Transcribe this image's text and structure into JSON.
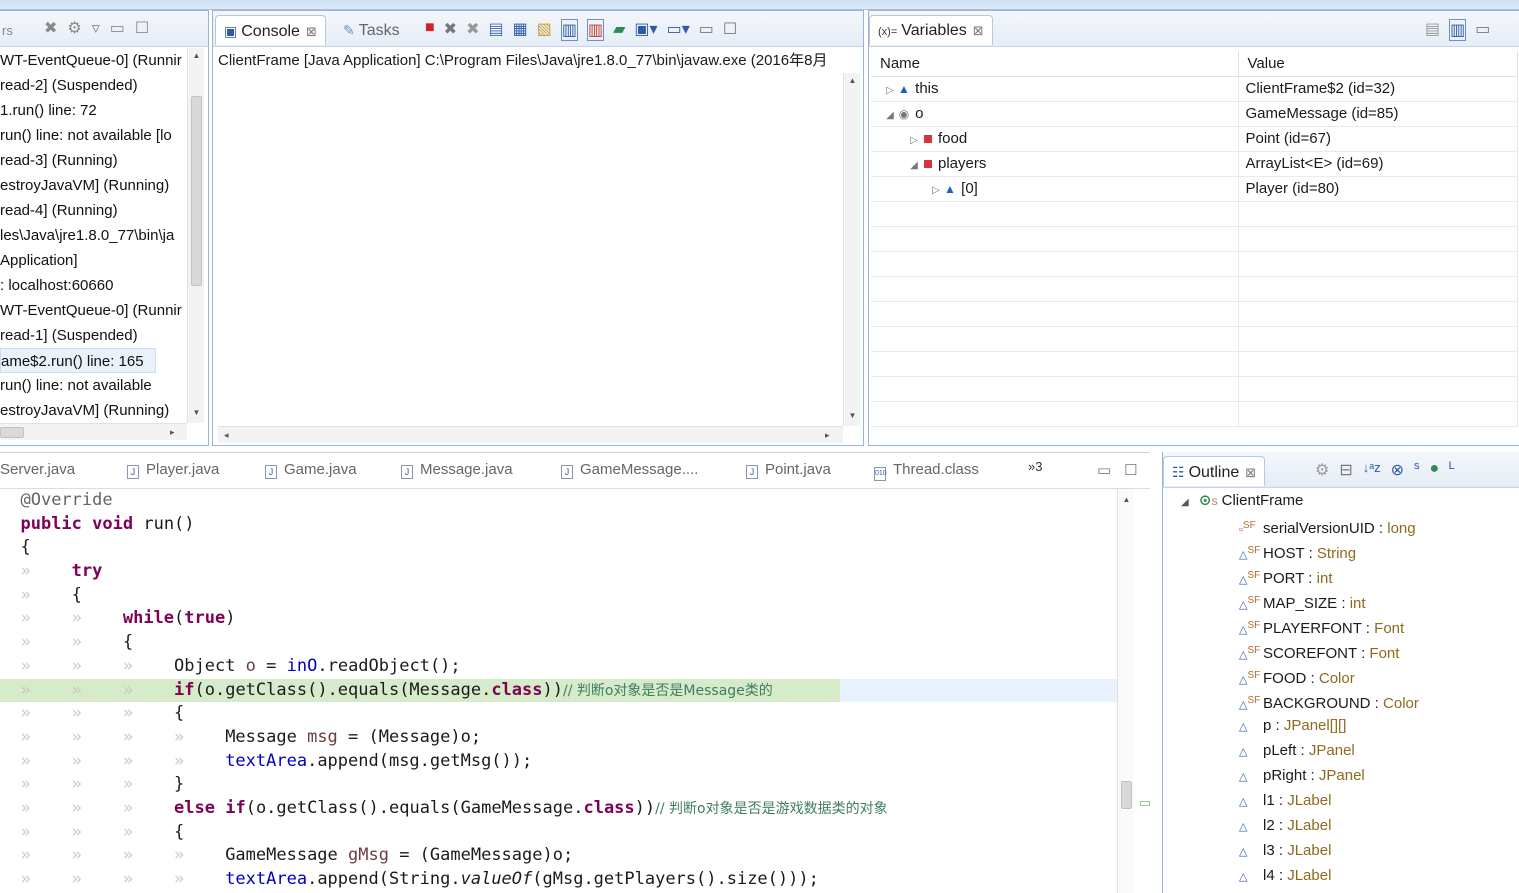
{
  "debug": {
    "toolbar_fragment": "rs",
    "threads": [
      "WT-EventQueue-0] (Runnir",
      "read-2] (Suspended)",
      "1.run() line: 72",
      "run() line: not available [lo",
      "read-3] (Running)",
      "estroyJavaVM] (Running)",
      "read-4] (Running)",
      "les\\Java\\jre1.8.0_77\\bin\\ja",
      " Application]",
      ": localhost:60660",
      "WT-EventQueue-0] (Runnir",
      "read-1] (Suspended)",
      "ame$2.run() line: 165",
      "run() line: not available",
      "estroyJavaVM] (Running)"
    ]
  },
  "console": {
    "tab_console": "Console",
    "tab_tasks": "Tasks",
    "launch_label": "ClientFrame [Java Application] C:\\Program Files\\Java\\jre1.8.0_77\\bin\\javaw.exe (2016年8月"
  },
  "variables": {
    "tab_label": "Variables",
    "col_name": "Name",
    "col_value": "Value",
    "rows": [
      {
        "name": "this",
        "value": "ClientFrame$2  (id=32)"
      },
      {
        "name": "o",
        "value": "GameMessage  (id=85)"
      },
      {
        "name": "food",
        "value": "Point  (id=67)"
      },
      {
        "name": "players",
        "value": "ArrayList<E>  (id=69)"
      },
      {
        "name": "[0]",
        "value": "Player  (id=80)"
      }
    ]
  },
  "editor": {
    "tabs": [
      "Server.java",
      "Player.java",
      "Game.java",
      "Message.java",
      "GameMessage....",
      "Point.java",
      "Thread.class"
    ],
    "overflow": "»3",
    "code": {
      "l1": "@Override",
      "l2_kw1": "public",
      "l2_kw2": "void",
      "l2_rest": " run()",
      "l3": "{",
      "l4_kw": "try",
      "l5": "{",
      "l6_kw1": "while",
      "l6_kw2": "true",
      "l7": "{",
      "l8_a": "Object ",
      "l8_var": "o",
      "l8_b": " = ",
      "l8_fld": "inO",
      "l8_c": ".readObject();",
      "l9_kw": "if",
      "l9_a": "(o.getClass().equals(Message.",
      "l9_kw2": "class",
      "l9_b": "))",
      "l9_cmt": "// 判断o对象是否是Message类的",
      "l10": "{",
      "l11_a": "Message ",
      "l11_var": "msg",
      "l11_b": " = (Message)o;",
      "l12_fld": "textArea",
      "l12_b": ".append(msg.getMsg());",
      "l13": "}",
      "l14_kw": "else",
      "l14_kw2": "if",
      "l14_a": "(o.getClass().equals(GameMessage.",
      "l14_kw3": "class",
      "l14_b": "))",
      "l14_cmt": "// 判断o对象是否是游戏数据类的对象",
      "l15": "{",
      "l16_a": "GameMessage ",
      "l16_var": "gMsg",
      "l16_b": " = (GameMessage)o;",
      "l17_fld": "textArea",
      "l17_b": ".append(String.",
      "l17_it": "valueOf",
      "l17_c": "(gMsg.getPlayers().size()));"
    }
  },
  "outline": {
    "tab_label": "Outline",
    "class_name": "ClientFrame",
    "members": [
      {
        "name": "serialVersionUID",
        "type": "long"
      },
      {
        "name": "HOST",
        "type": "String"
      },
      {
        "name": "PORT",
        "type": "int"
      },
      {
        "name": "MAP_SIZE",
        "type": "int"
      },
      {
        "name": "PLAYERFONT",
        "type": "Font"
      },
      {
        "name": "SCOREFONT",
        "type": "Font"
      },
      {
        "name": "FOOD",
        "type": "Color"
      },
      {
        "name": "BACKGROUND",
        "type": "Color"
      },
      {
        "name": "p",
        "type": "JPanel[][]"
      },
      {
        "name": "pLeft",
        "type": "JPanel"
      },
      {
        "name": "pRight",
        "type": "JPanel"
      },
      {
        "name": "l1",
        "type": "JLabel"
      },
      {
        "name": "l2",
        "type": "JLabel"
      },
      {
        "name": "l3",
        "type": "JLabel"
      },
      {
        "name": "l4",
        "type": "JLabel"
      }
    ]
  },
  "colors": {
    "keyword": "#7f0055",
    "field": "#0000c0",
    "comment": "#3f7f5f",
    "current_line": "#d5ebc9",
    "panel_border": "#99b4d6"
  }
}
